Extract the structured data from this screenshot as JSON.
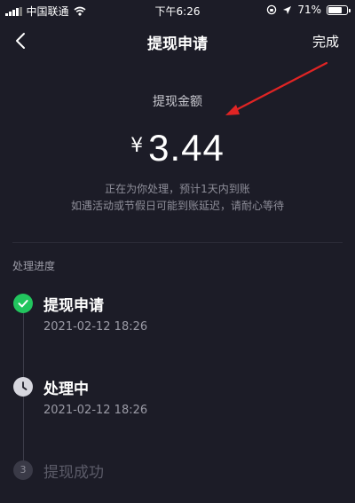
{
  "status_bar": {
    "carrier": "中国联通",
    "time": "下午6:26",
    "battery": "71%"
  },
  "nav": {
    "title": "提现申请",
    "done_label": "完成"
  },
  "amount": {
    "label": "提现金额",
    "currency": "¥",
    "value": "3.44",
    "note_line1": "正在为你处理，预计1天内到账",
    "note_line2": "如遇活动或节假日可能到账延迟，请耐心等待"
  },
  "progress": {
    "title": "处理进度",
    "steps": [
      {
        "title": "提现申请",
        "time": "2021-02-12 18:26",
        "state": "done"
      },
      {
        "title": "处理中",
        "time": "2021-02-12 18:26",
        "state": "pending"
      },
      {
        "title": "提现成功",
        "number": "3",
        "state": "todo"
      }
    ]
  },
  "colors": {
    "background": "#1c1c27",
    "success": "#22c55e",
    "annotation_arrow": "#e02424"
  }
}
